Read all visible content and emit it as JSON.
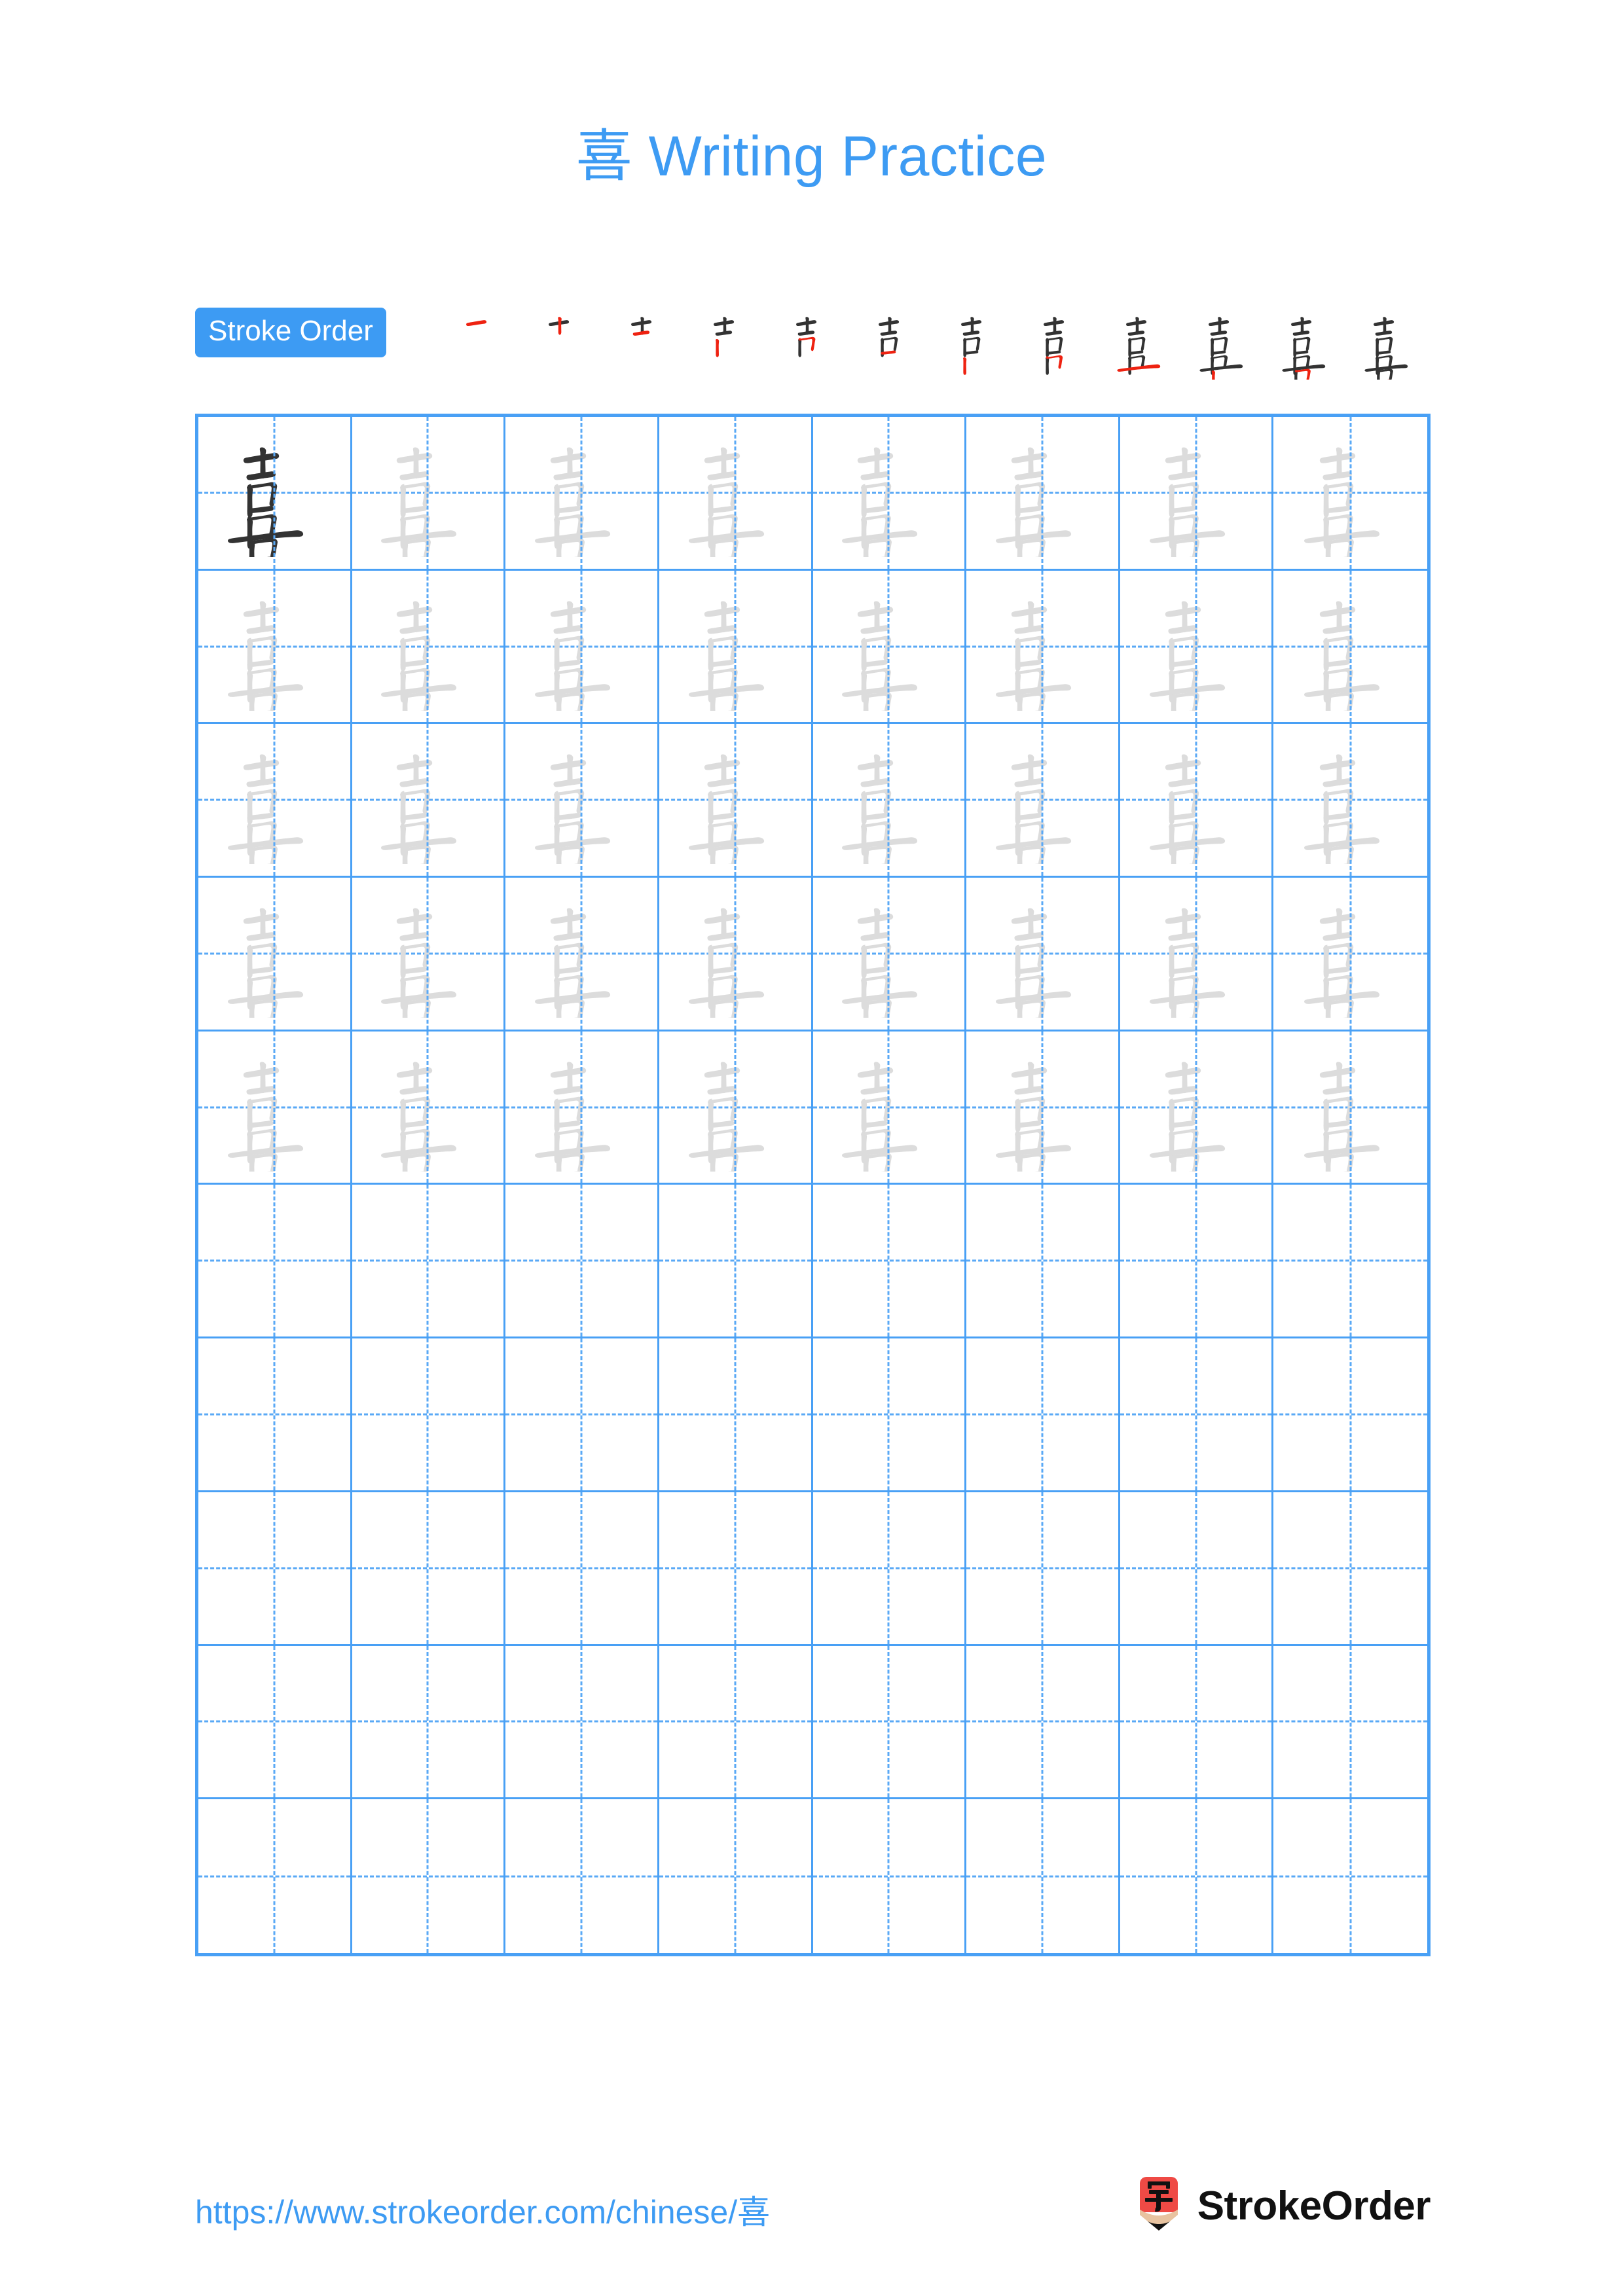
{
  "page": {
    "character": "喜",
    "title": "喜 Writing Practice",
    "background_color": "#ffffff",
    "accent_color": "#3d9bf3",
    "grid_line_color": "#49a0f5",
    "guide_line_color": "#5aa9f6",
    "traced_character_color": "#dcdcdc",
    "model_character_color": "#333333",
    "new_stroke_color": "#ee2211"
  },
  "stroke_order": {
    "badge_label": "Stroke Order",
    "total_strokes": 12,
    "steps": [
      {
        "index": 1,
        "partial": "一",
        "new_stroke": "heng (horizontal) top"
      },
      {
        "index": 2,
        "partial": "十",
        "new_stroke": "shu (vertical)"
      },
      {
        "index": 3,
        "partial": "士",
        "new_stroke": "heng (short horizontal)"
      },
      {
        "index": 4,
        "partial": "士",
        "new_stroke": "shu (left vertical of kou)"
      },
      {
        "index": 5,
        "partial": "吉",
        "new_stroke": "hengzhe (horizontal-turn)"
      },
      {
        "index": 6,
        "partial": "吉",
        "new_stroke": "heng (bottom of kou)"
      },
      {
        "index": 7,
        "partial": "壴",
        "new_stroke": "shu (vertical)"
      },
      {
        "index": 8,
        "partial": "壴",
        "new_stroke": "hengzhe (horizontal-turn)"
      },
      {
        "index": 9,
        "partial": "壴",
        "new_stroke": "heng (long horizontal)"
      },
      {
        "index": 10,
        "partial": "喜",
        "new_stroke": "shu (left vertical of lower kou)"
      },
      {
        "index": 11,
        "partial": "喜",
        "new_stroke": "hengzhe (horizontal-turn)"
      },
      {
        "index": 12,
        "partial": "喜",
        "new_stroke": "heng (bottom horizontal)"
      }
    ]
  },
  "practice_grid": {
    "columns": 8,
    "rows": 10,
    "model_cell": {
      "row": 1,
      "column": 1,
      "character": "喜",
      "style": "solid"
    },
    "traced_rows": 5,
    "blank_rows": 5,
    "cell_character": "喜"
  },
  "footer": {
    "url": "https://www.strokeorder.com/chinese/喜",
    "brand_name": "StrokeOrder",
    "logo_character": "字",
    "logo_colors": {
      "body": "#ef4a45",
      "wood": "#e8c3a0",
      "tip": "#111111"
    }
  }
}
